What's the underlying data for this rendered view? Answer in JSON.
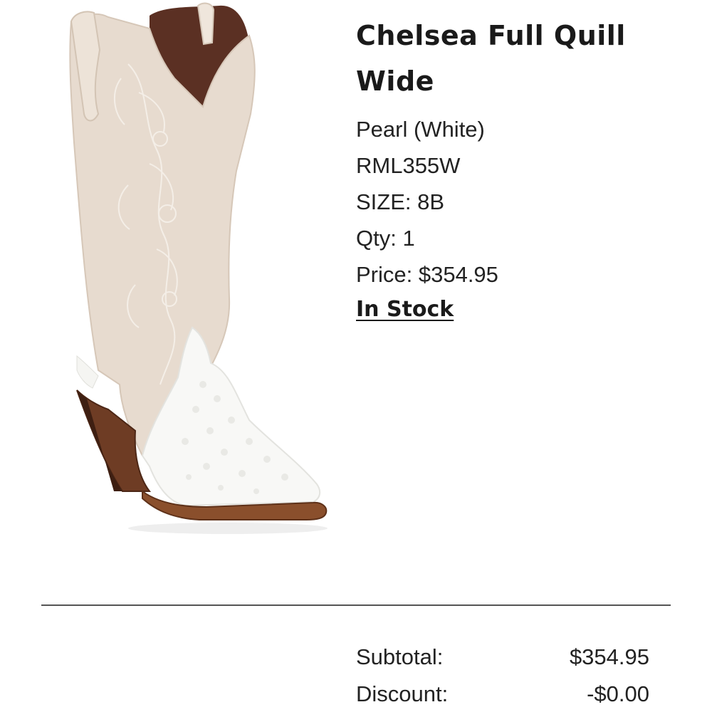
{
  "product": {
    "title": "Chelsea Full Quill Wide",
    "color": "Pearl (White)",
    "sku": "RML355W",
    "size": "SIZE: 8B",
    "qty": "Qty: 1",
    "price": "Price: $354.95",
    "stock_status": "In Stock",
    "image_alt_icon": "cowboy-boot"
  },
  "summary": {
    "subtotal_label": "Subtotal:",
    "subtotal_value": "$354.95",
    "discount_label": "Discount:",
    "discount_value": "-$0.00"
  },
  "colors": {
    "text": "#1e1e1e",
    "divider": "#555555",
    "boot_shaft": "#e6d9cc",
    "boot_toe": "#f7f7f5",
    "boot_heel": "#6b3a22",
    "boot_lining": "#5a2f22"
  }
}
